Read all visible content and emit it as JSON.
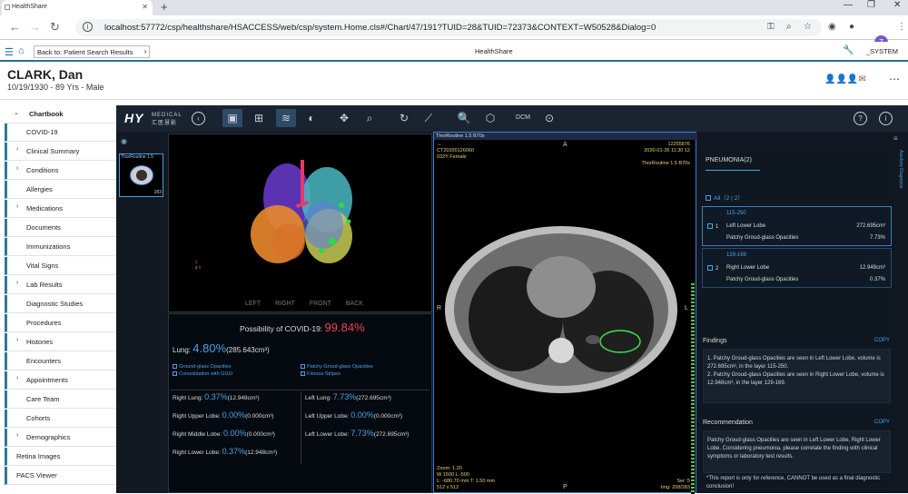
{
  "browser": {
    "tab_title": "HealthShare",
    "url": "localhost:57772/csp/healthshare/HSACCESS/web/csp/system.Home.cls#/Chart/47/191?TUID=28&TUID=72373&CONTEXT=W50528&Dialog=0",
    "profile_initial": "Z"
  },
  "app": {
    "back_button": "Back to: Patient Search Results",
    "title": "HealthShare",
    "user": "_SYSTEM"
  },
  "patient": {
    "name": "CLARK, Dan",
    "info": "10/19/1930 - 89 Yrs - Male"
  },
  "sidebar": {
    "header": "Chartbook",
    "items": [
      {
        "label": "COVID-19",
        "expandable": false
      },
      {
        "label": "Clinical Summary",
        "expandable": true
      },
      {
        "label": "Conditions",
        "expandable": true
      },
      {
        "label": "Allergies",
        "expandable": false
      },
      {
        "label": "Medications",
        "expandable": true
      },
      {
        "label": "Documents",
        "expandable": false
      },
      {
        "label": "Immunizations",
        "expandable": false
      },
      {
        "label": "Vital Signs",
        "expandable": false
      },
      {
        "label": "Lab Results",
        "expandable": true
      },
      {
        "label": "Diagnostic Studies",
        "expandable": false
      },
      {
        "label": "Procedures",
        "expandable": false
      },
      {
        "label": "Histories",
        "expandable": true
      },
      {
        "label": "Encounters",
        "expandable": false
      },
      {
        "label": "Appointments",
        "expandable": true
      },
      {
        "label": "Care Team",
        "expandable": false
      },
      {
        "label": "Cohorts",
        "expandable": false
      },
      {
        "label": "Demographics",
        "expandable": true
      },
      {
        "label": "Retina Images",
        "expandable": false
      },
      {
        "label": "PACS Viewer",
        "expandable": false
      }
    ]
  },
  "viewer": {
    "logo": "HY",
    "logo_sub": "MEDICAL",
    "logo_cn": "汇医慧影",
    "thumbnail": {
      "caption": "ThorRoutine 1.5",
      "count": "283"
    },
    "views": [
      "LEFT",
      "RIGHT",
      "FRONT",
      "BACK"
    ],
    "covid_label": "Possibility of COVID-19:",
    "covid_value": "99.84%",
    "lung_label": "Lung:",
    "lung_value": "4.80%",
    "lung_volume": "(285.643cm³)",
    "checks": [
      "Ground-glass Opacities",
      "Consolidation with GGO",
      "Patchy Groud-glass Opacities",
      "Fibrous Stripes"
    ],
    "right_lung": {
      "label": "Right Lung:",
      "value": "0.37%",
      "volume": "(12.948cm³)"
    },
    "left_lung": {
      "label": "Left Lung:",
      "value": "7.73%",
      "volume": "(272.695cm³)"
    },
    "lobes_right": [
      {
        "label": "Right Upper Lobe:",
        "value": "0.00%",
        "volume": "(0.000cm³)"
      },
      {
        "label": "Right Middle Lobe:",
        "value": "0.00%",
        "volume": "(0.000cm³)"
      },
      {
        "label": "Right Lower Lobe:",
        "value": "0.37%",
        "volume": "(12.948cm³)"
      }
    ],
    "lobes_left": [
      {
        "label": "Left Upper Lobe:",
        "value": "0.00%",
        "volume": "(0.000cm³)"
      },
      {
        "label": "Left Lower Lobe:",
        "value": "7.73%",
        "volume": "(272.695cm³)"
      }
    ],
    "ct": {
      "caption": "ThorRoutine 1.5 B70s",
      "tl1": "CT20200126060",
      "tl2": "032Y Female",
      "tr1": "12255876",
      "tr2": "2020-01-26 11:30 12",
      "tr3": "ThorRoutine 1.5 B70s",
      "top": "A",
      "left": "R",
      "right": "L",
      "bottom": "P",
      "bl1": "Zoom: 1.20",
      "bl2": "W 1500 L -500",
      "bl3": "L: -680.70 mm T: 1.50 mm",
      "bl4": "512 x 512",
      "br1": "Ser: 5",
      "br2": "Img: 208/283"
    },
    "right_panel": {
      "title": "PNEUMONIA(2)",
      "side_tab": "Auxiliary Diagnosis",
      "all": "All（2 | 2）",
      "findings_cards": [
        {
          "range": "115-250",
          "index": "1",
          "lobe": "Left Lower Lobe",
          "volume": "272.695cm³",
          "type": "Patchy Groud-glass Opacities",
          "percent": "7.73%"
        },
        {
          "range": "129-169",
          "index": "2",
          "lobe": "Right Lower Lobe",
          "volume": "12.948cm³",
          "type": "Patchy Groud-glass Opacities",
          "percent": "0.37%"
        }
      ],
      "findings_title": "Findings",
      "copy": "COPY",
      "findings_text": [
        "1. Patchy Groud-glass Opacities are seen in Left Lower Lobe, volume is 272.695cm³, in the layer 115-250.",
        "2. Patchy Groud-glass Opacities are seen in Right Lower Lobe, volume is 12.948cm³, in the layer 129-169."
      ],
      "recommendation_title": "Recommendation",
      "recommendation_text": "Patchy Groud-glass Opacities are seen in Left Lower Lobe, Right Lower Lobe. Considering pneumonia, please correlate the finding with clinical symptoms or laboratory test results.",
      "disclaimer": "*This report is only for reference, CANNOT be used as a final diagnostic conclusion!"
    }
  },
  "colors": {
    "accent": "#2a7d93",
    "danger": "#e8474a",
    "info": "#4aa3e6"
  }
}
